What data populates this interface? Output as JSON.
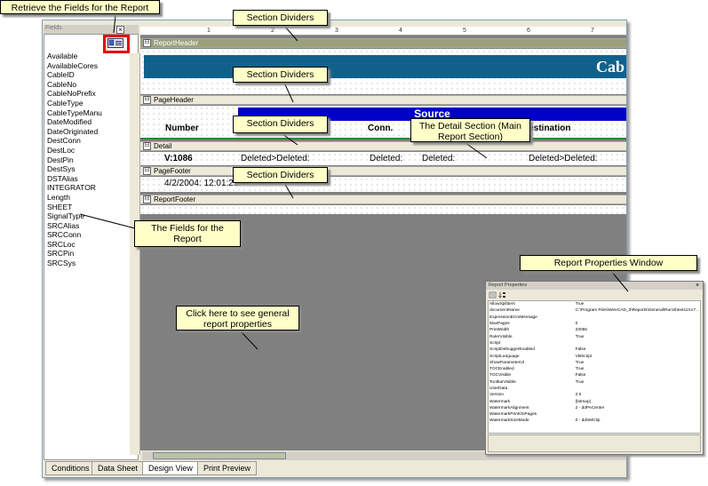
{
  "fields_panel": {
    "title": "Fields",
    "close_glyph": "×",
    "retrieve_icon": "fields-icon",
    "items": [
      "Available",
      "AvailableCores",
      "CableID",
      "CableNo",
      "CableNoPrefix",
      "CableType",
      "CableTypeManu",
      "DateModified",
      "DateOriginated",
      "DestConn",
      "DestLoc",
      "DestPin",
      "DestSys",
      "DSTAlias",
      "INTEGRATOR",
      "Length",
      "SHEET",
      "SignalType",
      "SRCAlias",
      "SRCConn",
      "SRCLoc",
      "SRCPin",
      "SRCSys"
    ]
  },
  "ruler": {
    "marks": [
      "1",
      "2",
      "3",
      "4",
      "5",
      "6",
      "7"
    ]
  },
  "sections": {
    "report_header": "ReportHeader",
    "page_header": "PageHeader",
    "detail": "Detail",
    "page_footer": "PageFooter",
    "report_footer": "ReportFooter",
    "expand_glyph": "⊟"
  },
  "report_content": {
    "cable_title": "Cab",
    "source_banner": "Source",
    "col_number": "Number",
    "col_conn": "Conn.",
    "col_destination": "Destination",
    "detail_v": "V:1086",
    "detail_deleted1": "Deleted>Deleted:",
    "detail_deleted2": "Deleted:",
    "detail_deleted3": "Deleted:",
    "detail_deleted4": "Deleted>Deleted:",
    "footer_date": "4/2/2004: 12:01:29"
  },
  "tabs": [
    "Conditions",
    "Data Sheet",
    "Design View",
    "Print Preview"
  ],
  "active_tab": "Design View",
  "callouts": {
    "retrieve": "Retrieve the Fields for the Report",
    "section1": "Section Dividers",
    "section2": "Section Dividers",
    "section3": "Section Dividers",
    "section4": "Section Dividers",
    "detail": "The Detail Section (Main Report Section)",
    "fields": "The Fields for the Report",
    "general": "Click here to see general report properties",
    "props_window": "Report Properties Window"
  },
  "properties_window": {
    "title": "Report Properties",
    "close_glyph": "×",
    "rows": [
      {
        "k": "AllowSplitters",
        "v": "True"
      },
      {
        "k": "documentName",
        "v": "C:\\Program Files\\WireCAD_3\\Reports\\General\\RunSheet11X17..."
      },
      {
        "k": "ExpressionErrorMessage",
        "v": ""
      },
      {
        "k": "MaxPages",
        "v": "0"
      },
      {
        "k": "PrintWidth",
        "v": "23055"
      },
      {
        "k": "RulerVisible",
        "v": "True"
      },
      {
        "k": "Script",
        "v": ""
      },
      {
        "k": "ScriptDebuggerEnabled",
        "v": "False"
      },
      {
        "k": "ScriptLanguage",
        "v": "VBScript"
      },
      {
        "k": "ShowParameterUI",
        "v": "True"
      },
      {
        "k": "TOCEnabled",
        "v": "True"
      },
      {
        "k": "TOCVisible",
        "v": "False"
      },
      {
        "k": "ToolbarVisible",
        "v": "True"
      },
      {
        "k": "UserData",
        "v": ""
      },
      {
        "k": "Version",
        "v": "2.0"
      },
      {
        "k": "Watermark",
        "v": "(bitmap)"
      },
      {
        "k": "WatermarkAlignment",
        "v": "2 - ddPACenter"
      },
      {
        "k": "WatermarkPrintOnPages",
        "v": ""
      },
      {
        "k": "WatermarkSizeMode",
        "v": "0 - ddSMClip"
      }
    ]
  }
}
